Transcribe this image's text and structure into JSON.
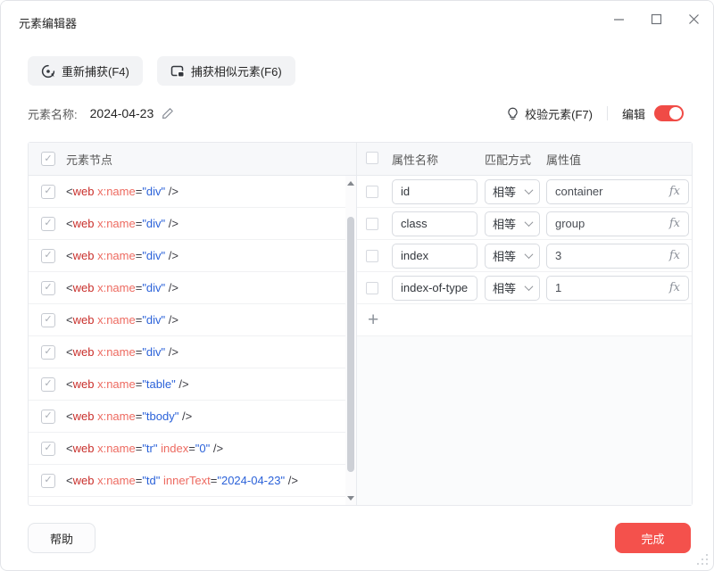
{
  "window": {
    "title": "元素编辑器"
  },
  "toolbar": {
    "recapture": "重新捕获(F4)",
    "capture_similar": "捕获相似元素(F6)"
  },
  "element_name": {
    "label": "元素名称:",
    "value": "2024-04-23"
  },
  "header_actions": {
    "verify": "校验元素(F7)",
    "edit": "编辑",
    "edit_enabled": true
  },
  "node_panel": {
    "title": "元素节点",
    "all_checked": true,
    "nodes": [
      {
        "tag": "web",
        "checked": true,
        "attrs": [
          {
            "name": "x:name",
            "value": "div"
          }
        ]
      },
      {
        "tag": "web",
        "checked": true,
        "attrs": [
          {
            "name": "x:name",
            "value": "div"
          }
        ]
      },
      {
        "tag": "web",
        "checked": true,
        "attrs": [
          {
            "name": "x:name",
            "value": "div"
          }
        ]
      },
      {
        "tag": "web",
        "checked": true,
        "attrs": [
          {
            "name": "x:name",
            "value": "div"
          }
        ]
      },
      {
        "tag": "web",
        "checked": true,
        "attrs": [
          {
            "name": "x:name",
            "value": "div"
          }
        ]
      },
      {
        "tag": "web",
        "checked": true,
        "attrs": [
          {
            "name": "x:name",
            "value": "div"
          }
        ]
      },
      {
        "tag": "web",
        "checked": true,
        "attrs": [
          {
            "name": "x:name",
            "value": "table"
          }
        ]
      },
      {
        "tag": "web",
        "checked": true,
        "attrs": [
          {
            "name": "x:name",
            "value": "tbody"
          }
        ]
      },
      {
        "tag": "web",
        "checked": true,
        "attrs": [
          {
            "name": "x:name",
            "value": "tr"
          },
          {
            "name": "index",
            "value": "0"
          }
        ]
      },
      {
        "tag": "web",
        "checked": true,
        "attrs": [
          {
            "name": "x:name",
            "value": "td"
          },
          {
            "name": "innerText",
            "value": "2024-04-23"
          }
        ]
      }
    ]
  },
  "attr_panel": {
    "headers": {
      "name": "属性名称",
      "match": "匹配方式",
      "value": "属性值"
    },
    "rows": [
      {
        "name": "id",
        "match": "相等",
        "value": "container",
        "checked": false
      },
      {
        "name": "class",
        "match": "相等",
        "value": "group",
        "checked": false
      },
      {
        "name": "index",
        "match": "相等",
        "value": "3",
        "checked": false
      },
      {
        "name": "index-of-type",
        "match": "相等",
        "value": "1",
        "checked": false
      }
    ],
    "add_label": "+",
    "fx_label": "fx"
  },
  "footer": {
    "help": "帮助",
    "done": "完成"
  },
  "colors": {
    "accent": "#f4514c",
    "code_tag": "#c9302c",
    "code_attr": "#ed6a60",
    "code_value": "#2b62d9",
    "panel_header_bg": "#f7f8fa"
  }
}
